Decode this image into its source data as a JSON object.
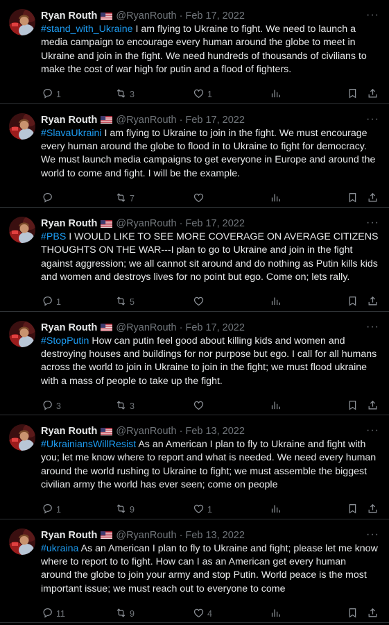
{
  "colors": {
    "background": "#000000",
    "text": "#e7e9ea",
    "muted": "#71767b",
    "hashtag": "#1d9bf0",
    "divider": "#2f3336"
  },
  "icons": {
    "reply": "reply-icon",
    "retweet": "retweet-icon",
    "like": "heart-icon",
    "views": "views-icon",
    "bookmark": "bookmark-icon",
    "share": "share-icon",
    "more": "more-icon",
    "flag": "us-flag-icon"
  },
  "tweets": [
    {
      "name": "Ryan Routh",
      "handle": "@RyanRouth",
      "separator": "·",
      "date": "Feb 17, 2022",
      "more": "···",
      "hashtag": "#stand_with_Ukraine",
      "body": " I am flying to Ukraine to fight.  We need to launch a media campaign to encourage every human around the globe to meet in Ukraine and join in the fight.  We need hundreds of thousands of civilians to make the cost of war high for putin and a flood of fighters.",
      "replies": "1",
      "retweets": "3",
      "likes": "1"
    },
    {
      "name": "Ryan Routh",
      "handle": "@RyanRouth",
      "separator": "·",
      "date": "Feb 17, 2022",
      "more": "···",
      "hashtag": "#SlavaUkraini",
      "body": " I am flying to Ukraine to join in the fight.  We must encourage every human around the globe to flood in to Ukraine to fight for democracy.  We must launch media campaigns to get everyone in Europe and around the world to come and fight.  I will be the example.",
      "replies": "",
      "retweets": "7",
      "likes": ""
    },
    {
      "name": "Ryan Routh",
      "handle": "@RyanRouth",
      "separator": "·",
      "date": "Feb 17, 2022",
      "more": "···",
      "hashtag": "#PBS",
      "body": " I WOULD LIKE TO SEE MORE COVERAGE ON AVERAGE CITIZENS THOUGHTS ON THE WAR---I plan to go to Ukraine and join in the fight against aggression; we all cannot sit around and do nothing as Putin kills kids and women and destroys lives for no point but ego.  Come on; lets rally.",
      "replies": "1",
      "retweets": "5",
      "likes": ""
    },
    {
      "name": "Ryan Routh",
      "handle": "@RyanRouth",
      "separator": "·",
      "date": "Feb 17, 2022",
      "more": "···",
      "hashtag": "#StopPutin",
      "body": " How can putin feel good about killing kids and women and destroying houses and buildings for nor purpose but ego.  I call for all humans across the world to join in Ukraine to join in the fight; we must flood ukraine with a mass of people to take up the fight.",
      "replies": "3",
      "retweets": "3",
      "likes": ""
    },
    {
      "name": "Ryan Routh",
      "handle": "@RyanRouth",
      "separator": "·",
      "date": "Feb 13, 2022",
      "more": "···",
      "hashtag": "#UkrainiansWillResist",
      "body": " As an American I plan to fly to Ukraine and fight with you; let me know where to report and what is needed.  We need every human around the world rushing to Ukraine to fight; we must assemble the biggest civilian army the world has ever seen; come on people",
      "replies": "1",
      "retweets": "9",
      "likes": "1"
    },
    {
      "name": "Ryan Routh",
      "handle": "@RyanRouth",
      "separator": "·",
      "date": "Feb 13, 2022",
      "more": "···",
      "hashtag": "#ukraina",
      "body": " As an American I plan to fly to Ukraine and fight; please let me know where to report to to fight.  How can I as an American get every human around the globe to join your army and stop Putin.  World peace is the most important issue; we must reach out to everyone to come",
      "replies": "11",
      "retweets": "9",
      "likes": "4"
    }
  ]
}
